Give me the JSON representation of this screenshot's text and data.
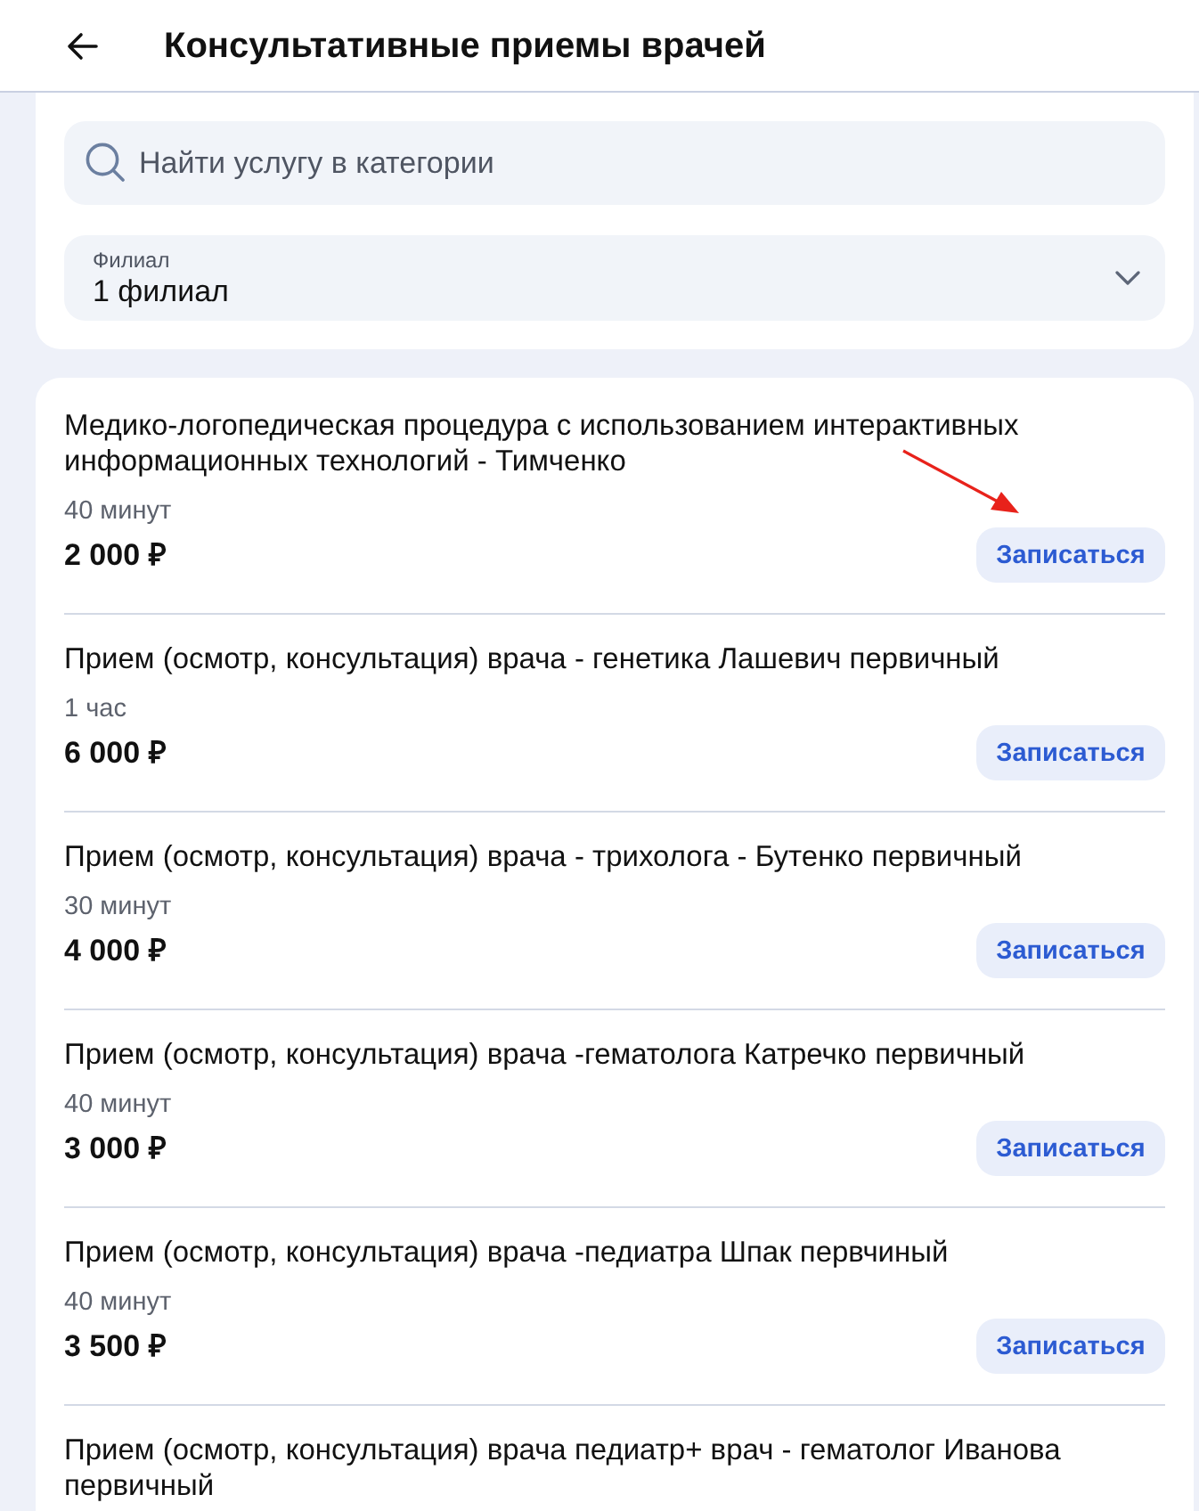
{
  "header": {
    "title": "Консультативные приемы врачей"
  },
  "search": {
    "placeholder": "Найти услугу в категории"
  },
  "filter": {
    "label": "Филиал",
    "value": "1 филиал"
  },
  "services": [
    {
      "title": "Медико-логопедическая процедура с использованием интерактивных информационных технологий - Тимченко",
      "duration": "40 минут",
      "price": "2 000 ₽",
      "button": "Записаться"
    },
    {
      "title": "Прием (осмотр, консультация) врача - генетика Лашевич первичный",
      "duration": "1 час",
      "price": "6 000 ₽",
      "button": "Записаться"
    },
    {
      "title": "Прием (осмотр, консультация) врача - трихолога - Бутенко первичный",
      "duration": "30 минут",
      "price": "4 000 ₽",
      "button": "Записаться"
    },
    {
      "title": "Прием (осмотр, консультация) врача -гематолога Катречко первичный",
      "duration": "40 минут",
      "price": "3 000 ₽",
      "button": "Записаться"
    },
    {
      "title": "Прием (осмотр, консультация) врача -педиатра Шпак первчиный",
      "duration": "40 минут",
      "price": "3 500 ₽",
      "button": "Записаться"
    },
    {
      "title": "Прием (осмотр, консультация) врача педиатр+ врач - гематолог Иванова первичный"
    }
  ]
}
